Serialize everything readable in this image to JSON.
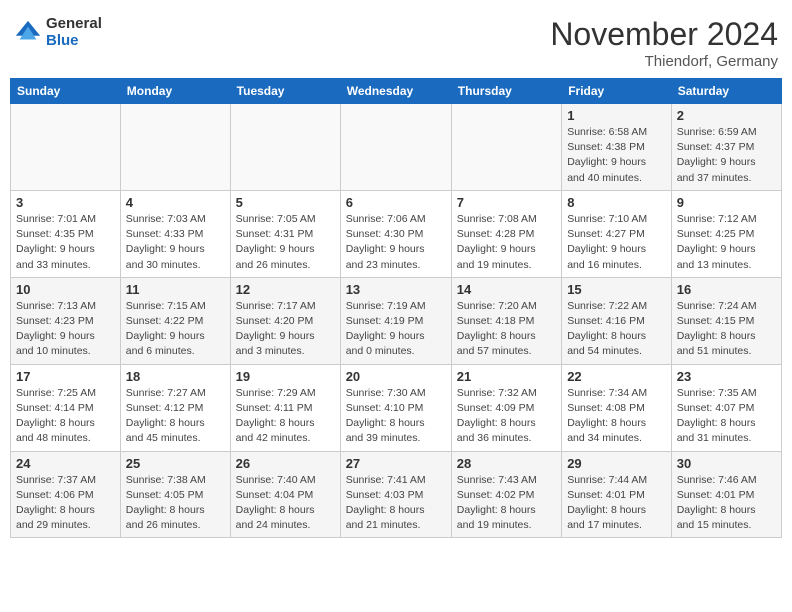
{
  "logo": {
    "general": "General",
    "blue": "Blue"
  },
  "title": "November 2024",
  "location": "Thiendorf, Germany",
  "days_of_week": [
    "Sunday",
    "Monday",
    "Tuesday",
    "Wednesday",
    "Thursday",
    "Friday",
    "Saturday"
  ],
  "weeks": [
    [
      {
        "day": "",
        "info": ""
      },
      {
        "day": "",
        "info": ""
      },
      {
        "day": "",
        "info": ""
      },
      {
        "day": "",
        "info": ""
      },
      {
        "day": "",
        "info": ""
      },
      {
        "day": "1",
        "info": "Sunrise: 6:58 AM\nSunset: 4:38 PM\nDaylight: 9 hours\nand 40 minutes."
      },
      {
        "day": "2",
        "info": "Sunrise: 6:59 AM\nSunset: 4:37 PM\nDaylight: 9 hours\nand 37 minutes."
      }
    ],
    [
      {
        "day": "3",
        "info": "Sunrise: 7:01 AM\nSunset: 4:35 PM\nDaylight: 9 hours\nand 33 minutes."
      },
      {
        "day": "4",
        "info": "Sunrise: 7:03 AM\nSunset: 4:33 PM\nDaylight: 9 hours\nand 30 minutes."
      },
      {
        "day": "5",
        "info": "Sunrise: 7:05 AM\nSunset: 4:31 PM\nDaylight: 9 hours\nand 26 minutes."
      },
      {
        "day": "6",
        "info": "Sunrise: 7:06 AM\nSunset: 4:30 PM\nDaylight: 9 hours\nand 23 minutes."
      },
      {
        "day": "7",
        "info": "Sunrise: 7:08 AM\nSunset: 4:28 PM\nDaylight: 9 hours\nand 19 minutes."
      },
      {
        "day": "8",
        "info": "Sunrise: 7:10 AM\nSunset: 4:27 PM\nDaylight: 9 hours\nand 16 minutes."
      },
      {
        "day": "9",
        "info": "Sunrise: 7:12 AM\nSunset: 4:25 PM\nDaylight: 9 hours\nand 13 minutes."
      }
    ],
    [
      {
        "day": "10",
        "info": "Sunrise: 7:13 AM\nSunset: 4:23 PM\nDaylight: 9 hours\nand 10 minutes."
      },
      {
        "day": "11",
        "info": "Sunrise: 7:15 AM\nSunset: 4:22 PM\nDaylight: 9 hours\nand 6 minutes."
      },
      {
        "day": "12",
        "info": "Sunrise: 7:17 AM\nSunset: 4:20 PM\nDaylight: 9 hours\nand 3 minutes."
      },
      {
        "day": "13",
        "info": "Sunrise: 7:19 AM\nSunset: 4:19 PM\nDaylight: 9 hours\nand 0 minutes."
      },
      {
        "day": "14",
        "info": "Sunrise: 7:20 AM\nSunset: 4:18 PM\nDaylight: 8 hours\nand 57 minutes."
      },
      {
        "day": "15",
        "info": "Sunrise: 7:22 AM\nSunset: 4:16 PM\nDaylight: 8 hours\nand 54 minutes."
      },
      {
        "day": "16",
        "info": "Sunrise: 7:24 AM\nSunset: 4:15 PM\nDaylight: 8 hours\nand 51 minutes."
      }
    ],
    [
      {
        "day": "17",
        "info": "Sunrise: 7:25 AM\nSunset: 4:14 PM\nDaylight: 8 hours\nand 48 minutes."
      },
      {
        "day": "18",
        "info": "Sunrise: 7:27 AM\nSunset: 4:12 PM\nDaylight: 8 hours\nand 45 minutes."
      },
      {
        "day": "19",
        "info": "Sunrise: 7:29 AM\nSunset: 4:11 PM\nDaylight: 8 hours\nand 42 minutes."
      },
      {
        "day": "20",
        "info": "Sunrise: 7:30 AM\nSunset: 4:10 PM\nDaylight: 8 hours\nand 39 minutes."
      },
      {
        "day": "21",
        "info": "Sunrise: 7:32 AM\nSunset: 4:09 PM\nDaylight: 8 hours\nand 36 minutes."
      },
      {
        "day": "22",
        "info": "Sunrise: 7:34 AM\nSunset: 4:08 PM\nDaylight: 8 hours\nand 34 minutes."
      },
      {
        "day": "23",
        "info": "Sunrise: 7:35 AM\nSunset: 4:07 PM\nDaylight: 8 hours\nand 31 minutes."
      }
    ],
    [
      {
        "day": "24",
        "info": "Sunrise: 7:37 AM\nSunset: 4:06 PM\nDaylight: 8 hours\nand 29 minutes."
      },
      {
        "day": "25",
        "info": "Sunrise: 7:38 AM\nSunset: 4:05 PM\nDaylight: 8 hours\nand 26 minutes."
      },
      {
        "day": "26",
        "info": "Sunrise: 7:40 AM\nSunset: 4:04 PM\nDaylight: 8 hours\nand 24 minutes."
      },
      {
        "day": "27",
        "info": "Sunrise: 7:41 AM\nSunset: 4:03 PM\nDaylight: 8 hours\nand 21 minutes."
      },
      {
        "day": "28",
        "info": "Sunrise: 7:43 AM\nSunset: 4:02 PM\nDaylight: 8 hours\nand 19 minutes."
      },
      {
        "day": "29",
        "info": "Sunrise: 7:44 AM\nSunset: 4:01 PM\nDaylight: 8 hours\nand 17 minutes."
      },
      {
        "day": "30",
        "info": "Sunrise: 7:46 AM\nSunset: 4:01 PM\nDaylight: 8 hours\nand 15 minutes."
      }
    ]
  ]
}
